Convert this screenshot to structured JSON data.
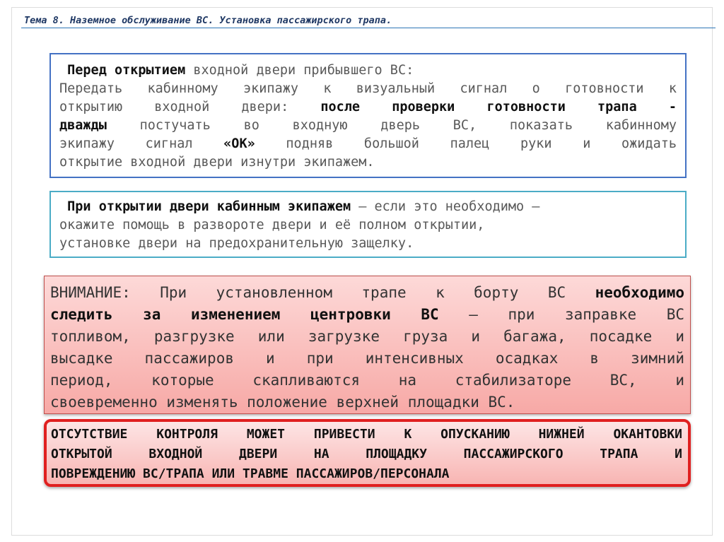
{
  "title": "Тема 8. Наземное обслуживание ВС. Установка пассажирского трапа.",
  "box1": {
    "heading_bold": "Перед открытием",
    "heading_rest": " входной двери прибывшего ВС:",
    "l2": "Передать кабинному экипажу к визуальный сигнал о готовности к",
    "l3_a": "открытию входной двери: ",
    "l3_b": "после проверки готовности трапа -",
    "l4_a": "дважды",
    "l4_b": " постучать во входную дверь ВС, показать кабинному",
    "l5_a": "экипажу сигнал ",
    "l5_b": "«ОК»",
    "l5_c": " подняв большой палец руки и ожидать",
    "l6": "открытие входной двери изнутри экипажем."
  },
  "box2": {
    "l1_bold": "При открытии двери кабинным экипажем",
    "l1_rest": " – если это необходимо –",
    "l2": "окажите помощь в развороте двери и её полном открытии,",
    "l3": "установке двери на предохранительную защелку."
  },
  "box3": {
    "l1_a": "ВНИМАНИЕ:  При установленном трапе к борту ВС ",
    "l1_b": "необходимо",
    "l2_a": "следить за изменением центровки ВС",
    "l2_b": " – при заправке ВС",
    "l3": "топливом, разгрузке или загрузке груза и багажа, посадке и",
    "l4": "высадке пассажиров и при интенсивных осадках в зимний",
    "l5": "период, которые скапливаются на стабилизаторе ВС, и",
    "l6": "своевременно изменять положение верхней площадки ВС."
  },
  "box4": {
    "l1": "ОТСУТСТВИЕ КОНТРОЛЯ МОЖЕТ ПРИВЕСТИ К ОПУСКАНИЮ НИЖНЕЙ ОКАНТОВКИ",
    "l2": "ОТКРЫТОЙ ВХОДНОЙ ДВЕРИ НА ПЛОЩАДКУ ПАССАЖИРСКОГО ТРАПА И",
    "l3": "ПОВРЕЖДЕНИЮ ВС/ТРАПА ИЛИ ТРАВМЕ ПАССАЖИРОВ/ПЕРСОНАЛА"
  }
}
